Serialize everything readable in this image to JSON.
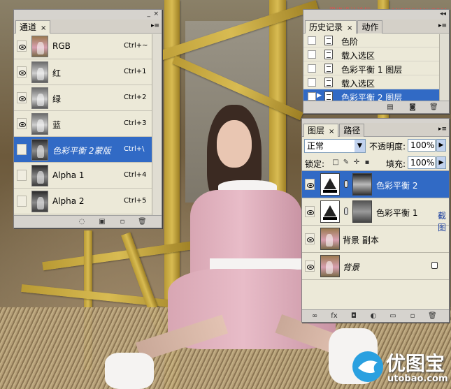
{
  "watermark_top": "思缘设计论坛 www.MISSYUAN.COM",
  "watermark_bottom": {
    "brand": "优图宝",
    "domain": "utobao.com"
  },
  "channels_panel": {
    "tab": "通道",
    "rows": [
      {
        "name": "RGB",
        "shortcut": "Ctrl+~",
        "visible": true,
        "selected": false
      },
      {
        "name": "红",
        "shortcut": "Ctrl+1",
        "visible": true,
        "selected": false
      },
      {
        "name": "绿",
        "shortcut": "Ctrl+2",
        "visible": true,
        "selected": false
      },
      {
        "name": "蓝",
        "shortcut": "Ctrl+3",
        "visible": true,
        "selected": false
      },
      {
        "name": "色彩平衡 2蒙版",
        "shortcut": "Ctrl+\\",
        "visible": false,
        "selected": true
      },
      {
        "name": "Alpha 1",
        "shortcut": "Ctrl+4",
        "visible": false,
        "selected": false
      },
      {
        "name": "Alpha 2",
        "shortcut": "Ctrl+5",
        "visible": false,
        "selected": false
      }
    ]
  },
  "history_panel": {
    "tabs": [
      "历史记录",
      "动作"
    ],
    "items": [
      {
        "name": "色阶",
        "selected": false
      },
      {
        "name": "载入选区",
        "selected": false
      },
      {
        "name": "色彩平衡 1 图层",
        "selected": false
      },
      {
        "name": "载入选区",
        "selected": false
      },
      {
        "name": "色彩平衡 2 图层",
        "selected": true
      }
    ]
  },
  "layers_panel": {
    "tabs": [
      "图层",
      "路径"
    ],
    "blend_mode": "正常",
    "opacity_label": "不透明度:",
    "opacity_value": "100%",
    "lock_label": "锁定:",
    "fill_label": "填充:",
    "fill_value": "100%",
    "side_text": "截图",
    "layers": [
      {
        "name": "色彩平衡 2",
        "selected": true
      },
      {
        "name": "色彩平衡 1",
        "selected": false
      },
      {
        "name": "背景 副本",
        "selected": false
      },
      {
        "name": "背景",
        "selected": false
      }
    ]
  }
}
